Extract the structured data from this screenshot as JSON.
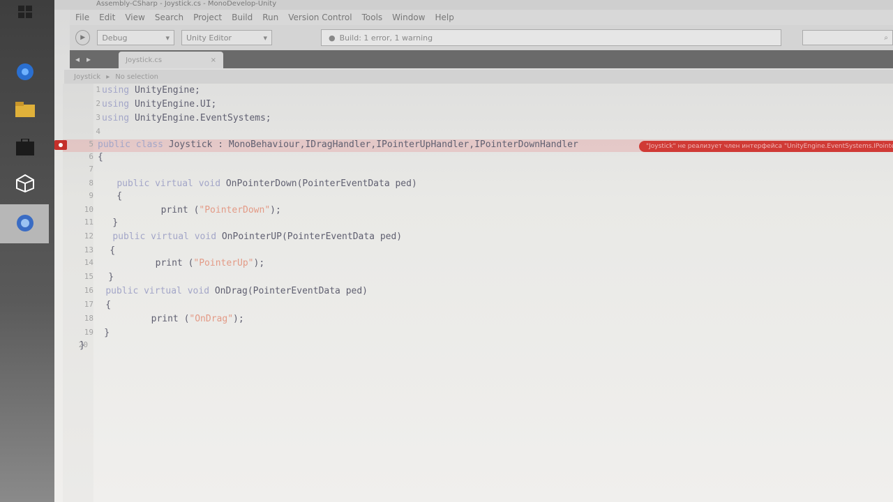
{
  "window": {
    "title": "Assembly-CSharp - Joystick.cs - MonoDevelop-Unity"
  },
  "menu": [
    "File",
    "Edit",
    "View",
    "Search",
    "Project",
    "Build",
    "Run",
    "Version Control",
    "Tools",
    "Window",
    "Help"
  ],
  "toolbar": {
    "config": "Debug",
    "target": "Unity Editor",
    "status": "Build: 1 error, 1 warning"
  },
  "tab": {
    "label": "Joystick.cs",
    "close": "×"
  },
  "breadcrumb": {
    "class": "Joystick",
    "member": "No selection"
  },
  "error": {
    "message": "\"Joystick\" не реализует член интерфейса \"UnityEngine.EventSystems.IPointerUpHandler.OnPointerUp(Unit"
  },
  "code": {
    "lines": [
      {
        "n": "1",
        "parts": [
          [
            "kw",
            "using"
          ],
          [
            "ty",
            " UnityEngine;"
          ]
        ]
      },
      {
        "n": "2",
        "parts": [
          [
            "kw",
            "using"
          ],
          [
            "ty",
            " UnityEngine.UI;"
          ]
        ]
      },
      {
        "n": "3",
        "parts": [
          [
            "kw",
            "using"
          ],
          [
            "ty",
            " UnityEngine.EventSystems;"
          ]
        ]
      },
      {
        "n": "4",
        "parts": []
      },
      {
        "n": "5",
        "parts": [
          [
            "kw",
            "public"
          ],
          [
            "ty",
            " "
          ],
          [
            "kw",
            "class"
          ],
          [
            "ty",
            " Joystick "
          ],
          [
            "ty",
            ": MonoBehaviour,IDragHandler,IPointerUpHandler,IPointerDownHandler"
          ]
        ]
      },
      {
        "n": "6",
        "parts": [
          [
            "ty",
            "{"
          ]
        ]
      },
      {
        "n": "7",
        "parts": []
      },
      {
        "n": "8",
        "parts": [
          [
            "ty",
            "    "
          ],
          [
            "kw",
            "public virtual void"
          ],
          [
            "ty",
            " OnPointerDown(PointerEventData ped)"
          ]
        ]
      },
      {
        "n": "9",
        "parts": [
          [
            "ty",
            "    {"
          ]
        ]
      },
      {
        "n": "10",
        "parts": [
          [
            "ty",
            "        print ("
          ],
          [
            "str",
            "\"PointerDown\""
          ],
          [
            "ty",
            ");"
          ]
        ]
      },
      {
        "n": "11",
        "parts": [
          [
            "ty",
            "    }"
          ]
        ]
      },
      {
        "n": "12",
        "parts": [
          [
            "ty",
            "    "
          ],
          [
            "kw",
            "public virtual void"
          ],
          [
            "ty",
            " OnPointerUP(PointerEventData ped)"
          ]
        ]
      },
      {
        "n": "13",
        "parts": [
          [
            "ty",
            "    {"
          ]
        ]
      },
      {
        "n": "14",
        "parts": [
          [
            "ty",
            "        print ("
          ],
          [
            "str",
            "\"PointerUp\""
          ],
          [
            "ty",
            ");"
          ]
        ]
      },
      {
        "n": "15",
        "parts": [
          [
            "ty",
            "    }"
          ]
        ]
      },
      {
        "n": "16",
        "parts": [
          [
            "ty",
            "    "
          ],
          [
            "kw",
            "public virtual void"
          ],
          [
            "ty",
            " OnDrag(PointerEventData ped)"
          ]
        ]
      },
      {
        "n": "17",
        "parts": [
          [
            "ty",
            "    {"
          ]
        ]
      },
      {
        "n": "18",
        "parts": [
          [
            "ty",
            "        print ("
          ],
          [
            "str",
            "\"OnDrag\""
          ],
          [
            "ty",
            ");"
          ]
        ]
      },
      {
        "n": "19",
        "parts": [
          [
            "ty",
            "    }"
          ]
        ]
      },
      {
        "n": "20",
        "parts": [
          [
            "ty",
            "}"
          ]
        ]
      }
    ]
  },
  "colors": {
    "error_red": "#d03a35",
    "keyword": "#a3a6c8",
    "string": "#e39a86"
  },
  "icons": [
    "windows-icon",
    "chrome-icon",
    "folder-icon",
    "store-icon",
    "unity-icon",
    "monodevelop-icon",
    "play-icon",
    "search-icon"
  ]
}
